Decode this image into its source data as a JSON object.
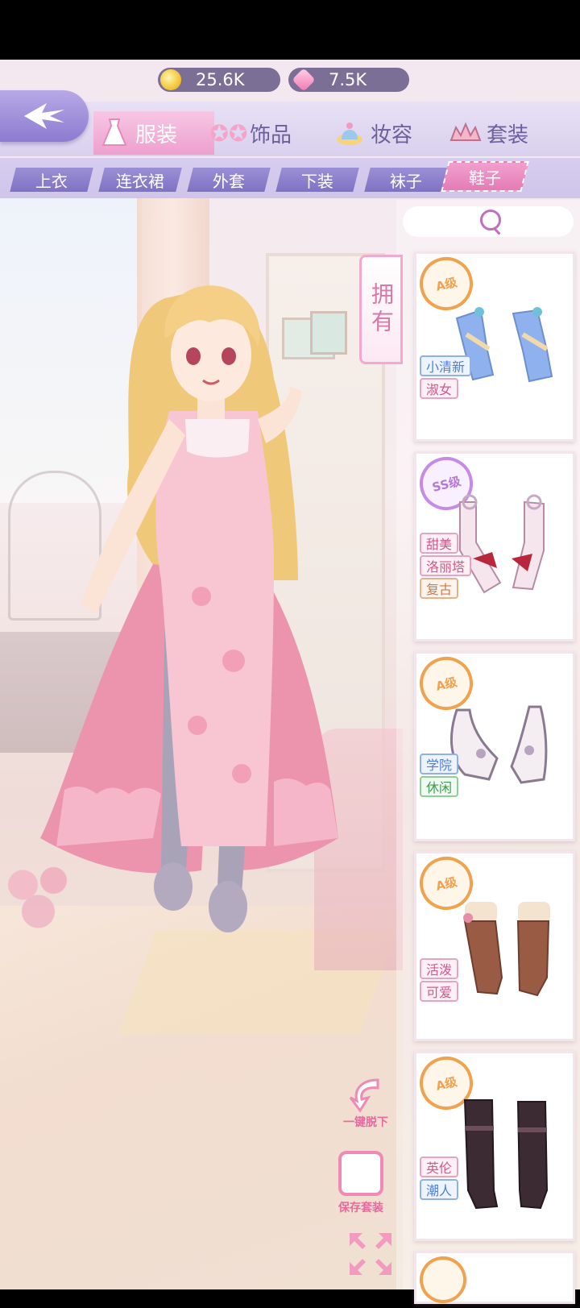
{
  "currency": {
    "coins": "25.6K",
    "gems": "7.5K"
  },
  "categories": [
    {
      "label": "服装",
      "icon": "dress-icon",
      "active": true
    },
    {
      "label": "饰品",
      "icon": "stars-icon",
      "active": false
    },
    {
      "label": "妆容",
      "icon": "hat-icon",
      "active": false
    },
    {
      "label": "套装",
      "icon": "tiara-icon",
      "active": false
    }
  ],
  "subtabs": [
    "上衣",
    "连衣裙",
    "外套",
    "下装",
    "袜子",
    "鞋子"
  ],
  "active_subtab": "鞋子",
  "owned_label": "拥有",
  "items": [
    {
      "grade": "A级",
      "tags": [
        "小清新",
        "淑女"
      ],
      "colors": [
        "#8fb2ee",
        "#f2d9a9"
      ]
    },
    {
      "grade": "SS级",
      "tags": [
        "甜美",
        "洛丽塔",
        "复古"
      ],
      "colors": [
        "#f4e6ec",
        "#b9273d"
      ]
    },
    {
      "grade": "A级",
      "tags": [
        "学院",
        "休闲"
      ],
      "colors": [
        "#f4eef3",
        "#b7a5c0"
      ]
    },
    {
      "grade": "A级",
      "tags": [
        "活泼",
        "可爱"
      ],
      "colors": [
        "#9a5b45",
        "#f3e3cf"
      ]
    },
    {
      "grade": "A级",
      "tags": [
        "英伦",
        "潮人"
      ],
      "colors": [
        "#3c2b33",
        "#6b4e5a"
      ]
    }
  ],
  "tools": {
    "undress": "一键脱下",
    "save_outfit": "保存套装"
  }
}
